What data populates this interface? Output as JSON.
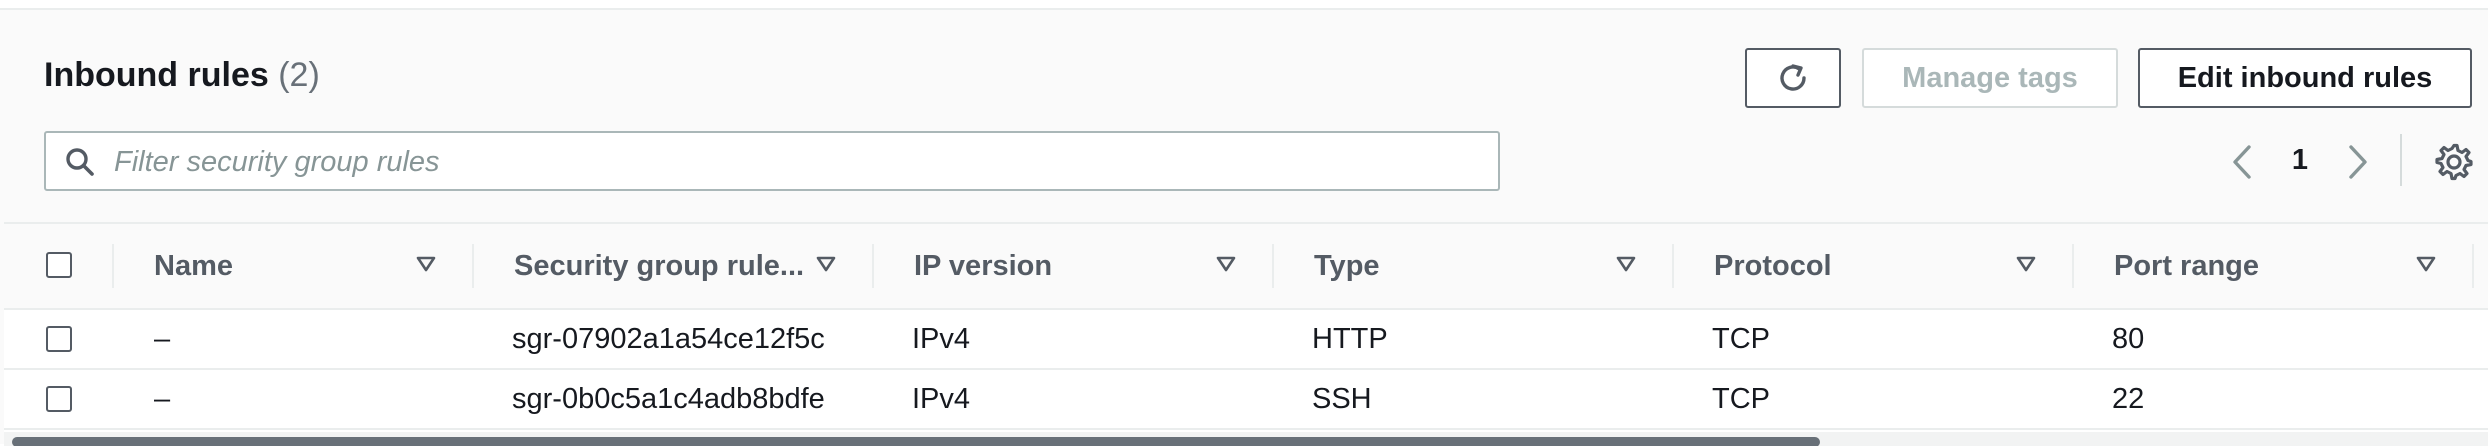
{
  "header": {
    "title": "Inbound rules",
    "count": "(2)"
  },
  "actions": {
    "refresh_icon": "refresh-icon",
    "manage_tags_label": "Manage tags",
    "edit_inbound_rules_label": "Edit inbound rules"
  },
  "filter": {
    "placeholder": "Filter security group rules",
    "value": ""
  },
  "pagination": {
    "current_page": "1"
  },
  "table": {
    "columns": [
      {
        "label": "Name"
      },
      {
        "label": "Security group rule..."
      },
      {
        "label": "IP version"
      },
      {
        "label": "Type"
      },
      {
        "label": "Protocol"
      },
      {
        "label": "Port range"
      }
    ],
    "rows": [
      {
        "name": "–",
        "rule_id": "sgr-07902a1a54ce12f5c",
        "ip_version": "IPv4",
        "type": "HTTP",
        "protocol": "TCP",
        "port_range": "80"
      },
      {
        "name": "–",
        "rule_id": "sgr-0b0c5a1c4adb8bdfe",
        "ip_version": "IPv4",
        "type": "SSH",
        "protocol": "TCP",
        "port_range": "22"
      }
    ]
  },
  "colors": {
    "text_primary": "#16191f",
    "text_secondary": "#545b64",
    "text_muted": "#687078",
    "disabled": "#aab7b8",
    "border": "#eaeded"
  }
}
